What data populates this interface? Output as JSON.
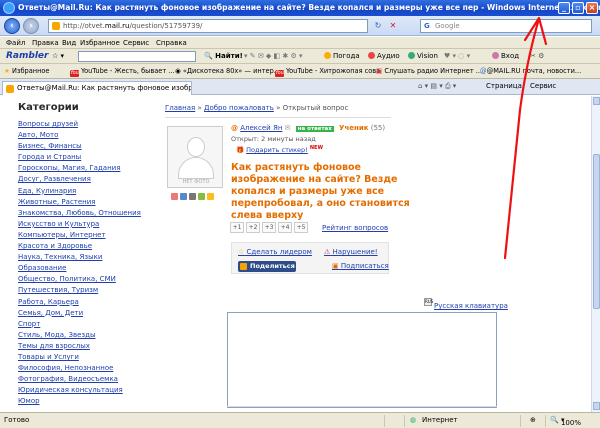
{
  "window": {
    "title": "Ответы@Mail.Ru: Как растянуть фоновое изображение на сайте? Везде копался и размеры уже все пер - Windows Internet Explorer"
  },
  "address": {
    "url_prefix": "http://otvet.",
    "url_host": "mail.ru",
    "url_path": "/question/51759739/",
    "search_engine": "Google",
    "search_placeholder": "Google"
  },
  "menu": [
    "Файл",
    "Правка",
    "Вид",
    "Избранное",
    "Сервис",
    "Справка"
  ],
  "rambler": {
    "logo": "Rambler",
    "find": "Найти!",
    "weather": "Погода",
    "audio": "Аудио",
    "vision": "Vision",
    "login": "Вход"
  },
  "favorites": {
    "label": "Избранное",
    "items": [
      "YouTube - Жесть, бывает ...",
      "«Дискотека 80х» — интер...",
      "YouTube - Хитрожопая сова",
      "Слушать радио Интернет ...",
      "@MAIL.RU почта, новости..."
    ]
  },
  "tab": {
    "title": "Ответы@Mail.Ru: Как растянуть фоновое изображ...",
    "tools": [
      "Страница",
      "Сервис"
    ]
  },
  "sidebar": {
    "heading": "Категории",
    "items": [
      "Вопросы друзей",
      "Авто, Мото",
      "Бизнес, Финансы",
      "Города и Страны",
      "Гороскопы, Магия, Гадания",
      "Досуг, Развлечения",
      "Еда, Кулинария",
      "Животные, Растения",
      "Знакомства, Любовь, Отношения",
      "Искусство и Культура",
      "Компьютеры, Интернет",
      "Красота и Здоровье",
      "Наука, Техника, Языки",
      "Образование",
      "Общество, Политика, СМИ",
      "Путешествия, Туризм",
      "Работа, Карьера",
      "Семья, Дом, Дети",
      "Спорт",
      "Стиль, Мода, Звезды",
      "Темы для взрослых",
      "Товары и Услуги",
      "Философия, Непознанное",
      "Фотография, Видеосъемка",
      "Юридическая консультация",
      "Юмор"
    ]
  },
  "breadcrumb": {
    "home": "Главная",
    "welcome": "Добро пожаловать",
    "sep": " » ",
    "current": "Открытый вопрос"
  },
  "question": {
    "avatar_text": "НЕТ ФОТО",
    "at": "@",
    "author": "Алексей Ян",
    "status_badge": "на ответах",
    "rank": "Ученик",
    "points": "(55)",
    "opened": "Открыт: 2 минуты назад",
    "gift_link": "Подарить стикер!",
    "gift_new": "NEW",
    "text": "Как растянуть фоновое изображение на сайте? Везде копался и размеры уже все перепробовал, а оно становится слева вверху"
  },
  "rating": {
    "buttons": [
      "+1",
      "+2",
      "+3",
      "+4",
      "+5"
    ],
    "link": "Рейтинг вопросов"
  },
  "actions": {
    "make_leader": "Сделать лидером",
    "violation": "Нарушение!",
    "share": "Поделиться",
    "subscribe": "Подписаться"
  },
  "answer": {
    "keyboard_link": "Русская клавиатура",
    "keyboard_icon": "RUS"
  },
  "status": {
    "left": "Готово",
    "zone": "Интернет",
    "zoom": "100%"
  },
  "colors": {
    "link": "#1f3fae",
    "accent_orange": "#e46d00",
    "badge_green": "#37b34a",
    "annotation_red": "#ee1111"
  }
}
